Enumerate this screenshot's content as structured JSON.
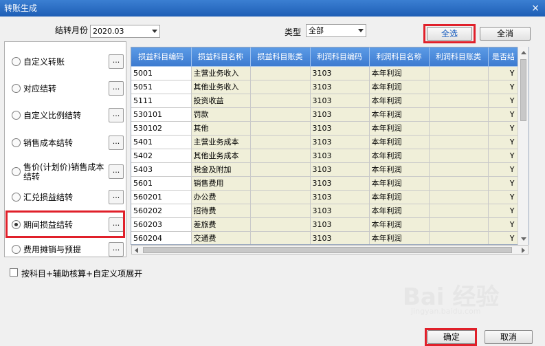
{
  "window": {
    "title": "转账生成",
    "close_glyph": "×"
  },
  "filters": {
    "month_label": "结转月份",
    "month_value": "2020.03",
    "type_label": "类型",
    "type_value": "全部"
  },
  "buttons": {
    "select_all": "全选",
    "cancel_all": "全消",
    "ok": "确定",
    "cancel": "取消"
  },
  "options": [
    {
      "label": "自定义转账",
      "selected": false
    },
    {
      "label": "对应结转",
      "selected": false
    },
    {
      "label": "自定义比例结转",
      "selected": false
    },
    {
      "label": "销售成本结转",
      "selected": false
    },
    {
      "label": "售价(计划价)销售成本结转",
      "selected": false
    },
    {
      "label": "汇兑损益结转",
      "selected": false
    },
    {
      "label": "期间损益结转",
      "selected": true
    },
    {
      "label": "费用摊销与预提",
      "selected": false
    }
  ],
  "option_button_label": "...",
  "table": {
    "columns": [
      "损益科目编码",
      "损益科目名称",
      "损益科目账类",
      "利润科目编码",
      "利润科目名称",
      "利润科目账类",
      "是否结"
    ],
    "rows": [
      [
        "5001",
        "主营业务收入",
        "",
        "3103",
        "本年利润",
        "",
        "Y"
      ],
      [
        "5051",
        "其他业务收入",
        "",
        "3103",
        "本年利润",
        "",
        "Y"
      ],
      [
        "5111",
        "投资收益",
        "",
        "3103",
        "本年利润",
        "",
        "Y"
      ],
      [
        "530101",
        "罚款",
        "",
        "3103",
        "本年利润",
        "",
        "Y"
      ],
      [
        "530102",
        "其他",
        "",
        "3103",
        "本年利润",
        "",
        "Y"
      ],
      [
        "5401",
        "主营业务成本",
        "",
        "3103",
        "本年利润",
        "",
        "Y"
      ],
      [
        "5402",
        "其他业务成本",
        "",
        "3103",
        "本年利润",
        "",
        "Y"
      ],
      [
        "5403",
        "税金及附加",
        "",
        "3103",
        "本年利润",
        "",
        "Y"
      ],
      [
        "5601",
        "销售费用",
        "",
        "3103",
        "本年利润",
        "",
        "Y"
      ],
      [
        "560201",
        "办公费",
        "",
        "3103",
        "本年利润",
        "",
        "Y"
      ],
      [
        "560202",
        "招待费",
        "",
        "3103",
        "本年利润",
        "",
        "Y"
      ],
      [
        "560203",
        "差旅费",
        "",
        "3103",
        "本年利润",
        "",
        "Y"
      ],
      [
        "560204",
        "交通费",
        "",
        "3103",
        "本年利润",
        "",
        "Y"
      ]
    ]
  },
  "expand_checkbox": {
    "label": "按科目+辅助核算+自定义项展开",
    "checked": false
  },
  "watermark": {
    "main": "Bai 经验",
    "sub": "jingyan.baidu.com"
  },
  "colors": {
    "title_bar": "#1e5eb5",
    "header": "#4a8ad9",
    "highlight": "#e0202a",
    "cell_fill": "#f0efd9"
  }
}
